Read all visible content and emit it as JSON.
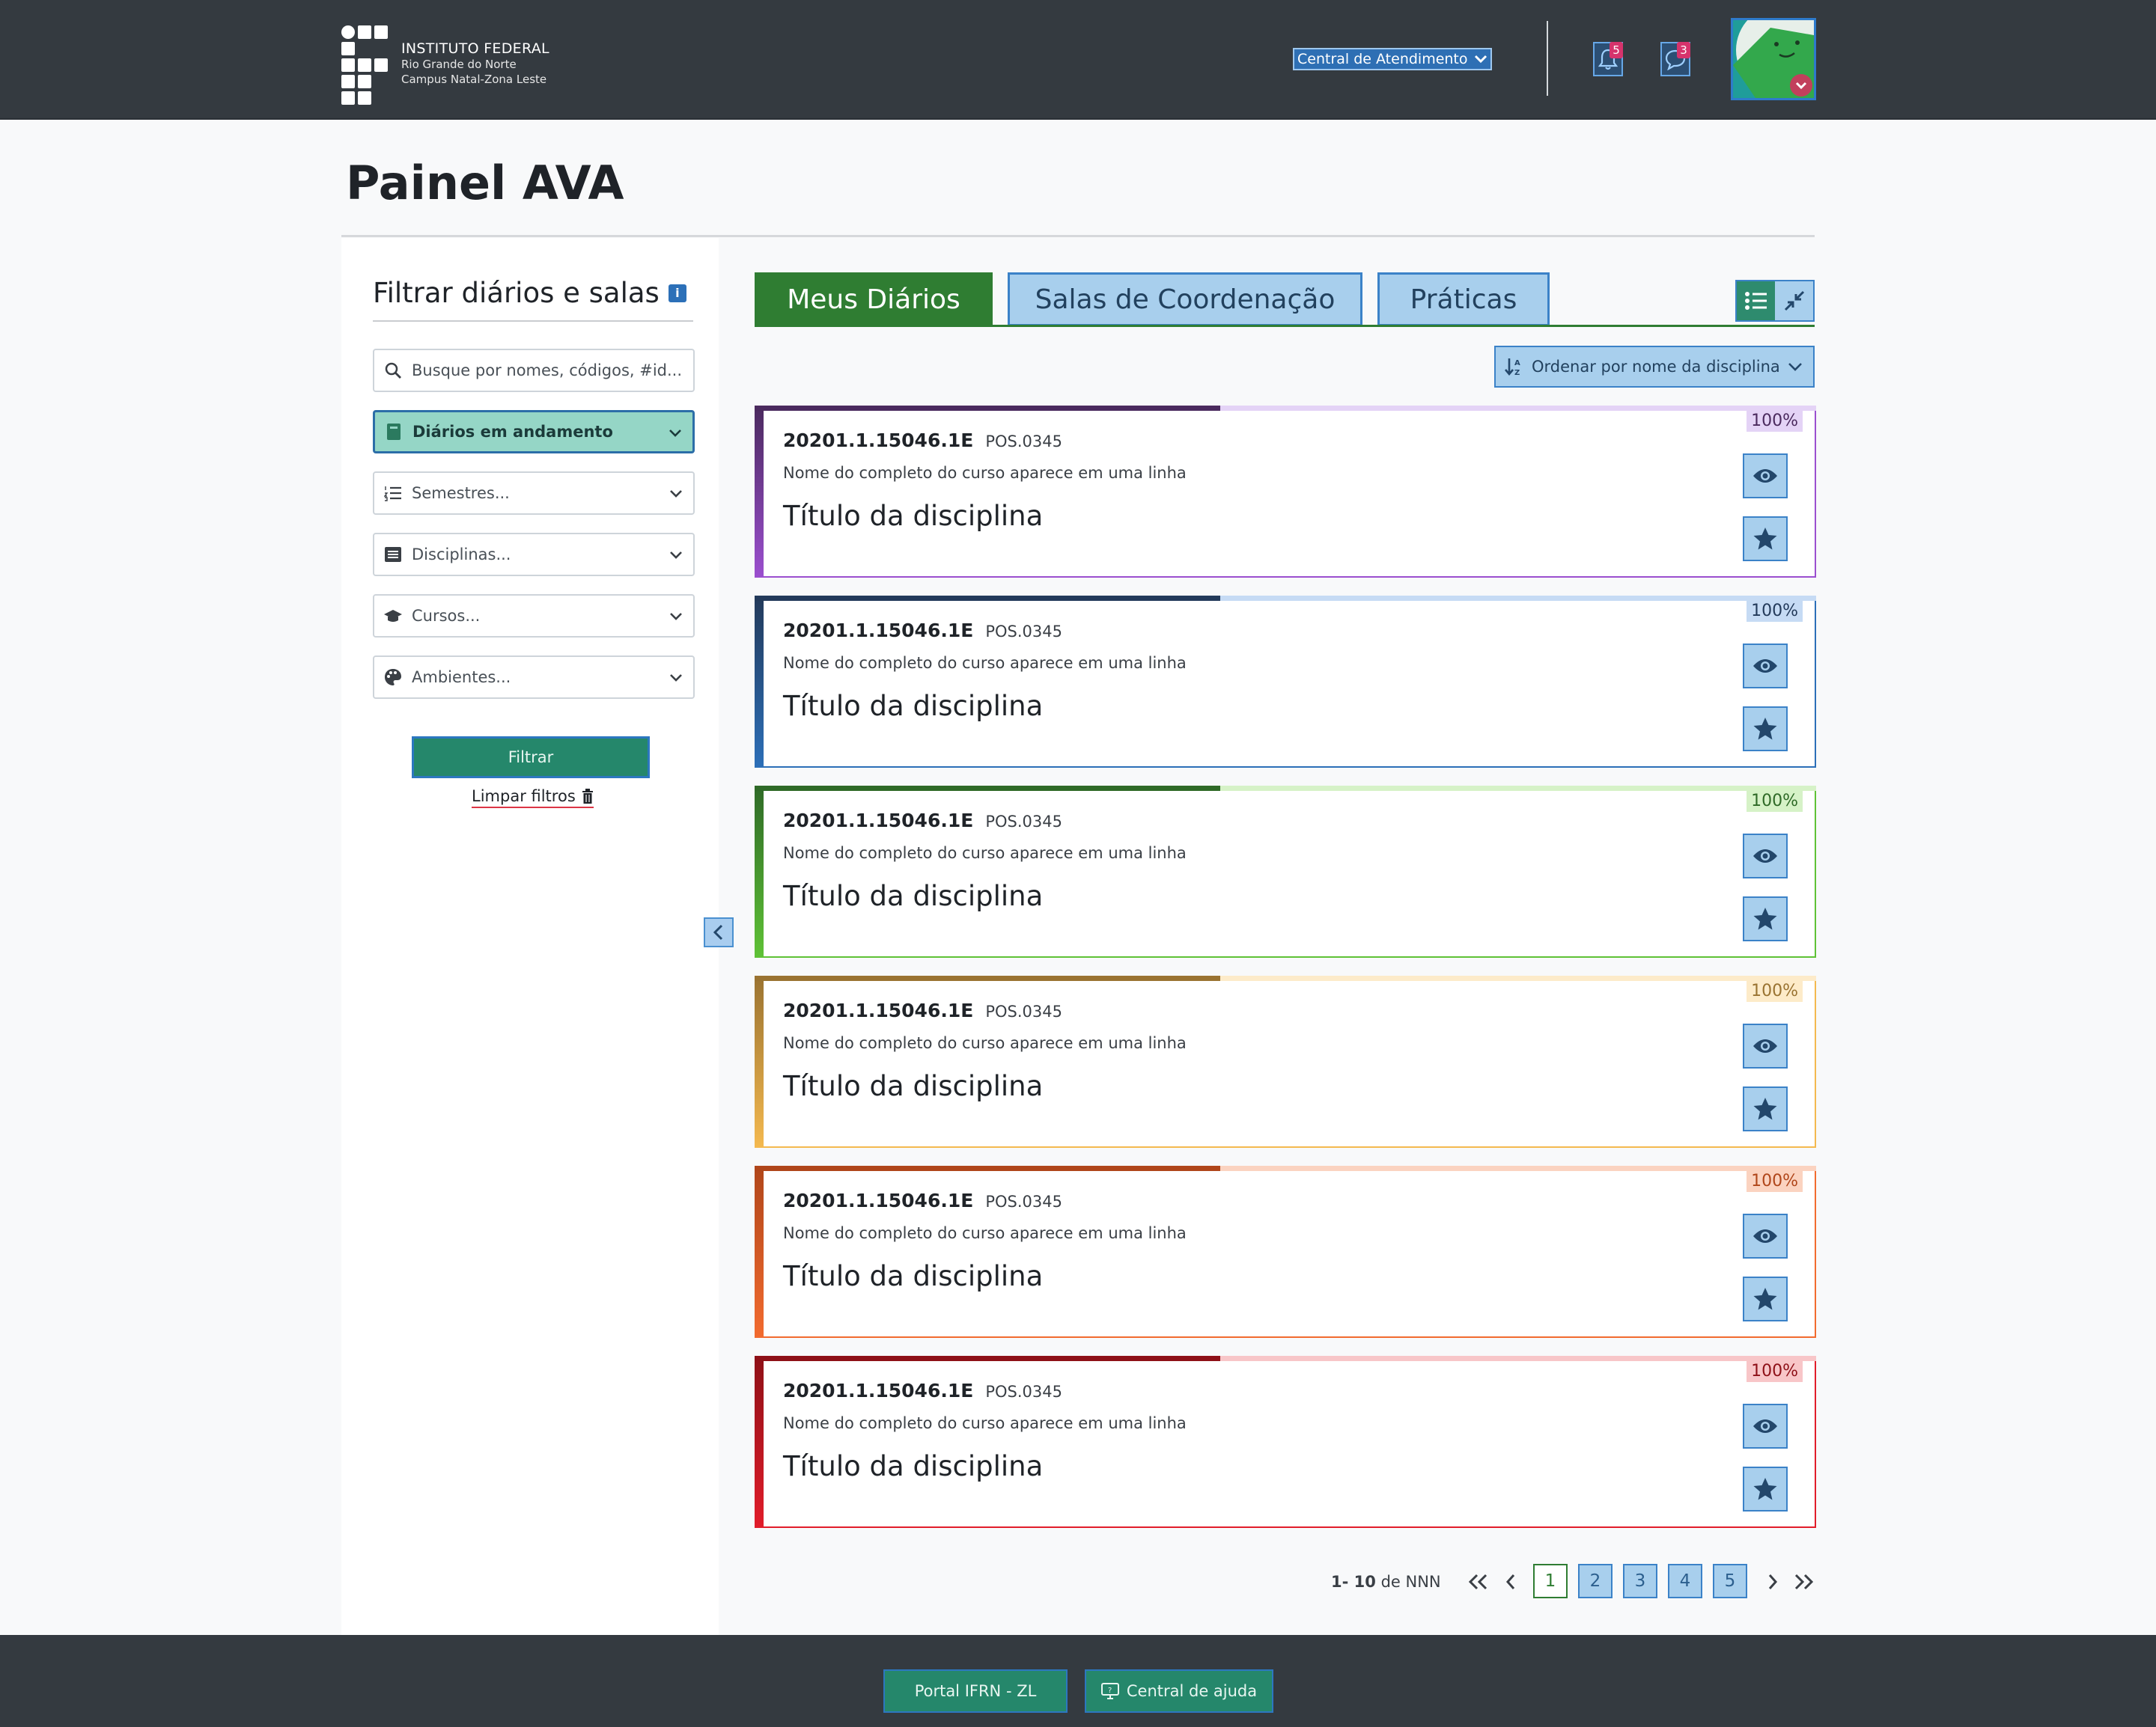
{
  "header": {
    "logo": {
      "title": "INSTITUTO FEDERAL",
      "line1": "Rio Grande do Norte",
      "line2": "Campus Natal-Zona Leste"
    },
    "central_label": "Central de Atendimento",
    "notifications_count": "5",
    "messages_count": "3"
  },
  "page": {
    "title": "Painel AVA"
  },
  "sidebar": {
    "heading": "Filtrar diários e salas",
    "search_placeholder": "Busque por nomes, códigos, #id...",
    "status_select": "Diários em andamento",
    "semestres": "Semestres...",
    "disciplinas": "Disciplinas...",
    "cursos": "Cursos...",
    "ambientes": "Ambientes...",
    "filter_button": "Filtrar",
    "clear_filters": "Limpar filtros"
  },
  "tabs": [
    {
      "label": "Meus Diários",
      "active": true
    },
    {
      "label": "Salas de Coordenação",
      "active": false
    },
    {
      "label": "Práticas",
      "active": false
    }
  ],
  "sort": {
    "label": "Ordenar por nome da disciplina"
  },
  "cards": [
    {
      "code": "20201.1.15046.1E",
      "pos": "POS.0345",
      "course": "Nome do completo do curso aparece em uma linha",
      "discipline": "Título da disciplina",
      "percent": "100%",
      "color": "#9b4fcf",
      "dark": "#4b2a5e",
      "light": "#e4d3f6"
    },
    {
      "code": "20201.1.15046.1E",
      "pos": "POS.0345",
      "course": "Nome do completo do curso aparece em uma linha",
      "discipline": "Título da disciplina",
      "percent": "100%",
      "color": "#2c6fb8",
      "dark": "#233a5a",
      "light": "#c6dbf4"
    },
    {
      "code": "20201.1.15046.1E",
      "pos": "POS.0345",
      "course": "Nome do completo do curso aparece em uma linha",
      "discipline": "Título da disciplina",
      "percent": "100%",
      "color": "#5fc236",
      "dark": "#2f6a27",
      "light": "#d6f2c7"
    },
    {
      "code": "20201.1.15046.1E",
      "pos": "POS.0345",
      "course": "Nome do completo do curso aparece em uma linha",
      "discipline": "Título da disciplina",
      "percent": "100%",
      "color": "#f4b94f",
      "dark": "#9a7331",
      "light": "#fdebc9"
    },
    {
      "code": "20201.1.15046.1E",
      "pos": "POS.0345",
      "course": "Nome do completo do curso aparece em uma linha",
      "discipline": "Título da disciplina",
      "percent": "100%",
      "color": "#f26b2f",
      "dark": "#b0461a",
      "light": "#fbd3c0"
    },
    {
      "code": "20201.1.15046.1E",
      "pos": "POS.0345",
      "course": "Nome do completo do curso aparece em uma linha",
      "discipline": "Título da disciplina",
      "percent": "100%",
      "color": "#e11d2a",
      "dark": "#8e1017",
      "light": "#f8c6c8"
    }
  ],
  "pagination": {
    "info_prefix": "1- 10",
    "info_suffix": "de NNN",
    "pages": [
      "1",
      "2",
      "3",
      "4",
      "5"
    ],
    "current": "1"
  },
  "footer": {
    "portal": "Portal IFRN - ZL",
    "help": "Central de ajuda"
  }
}
